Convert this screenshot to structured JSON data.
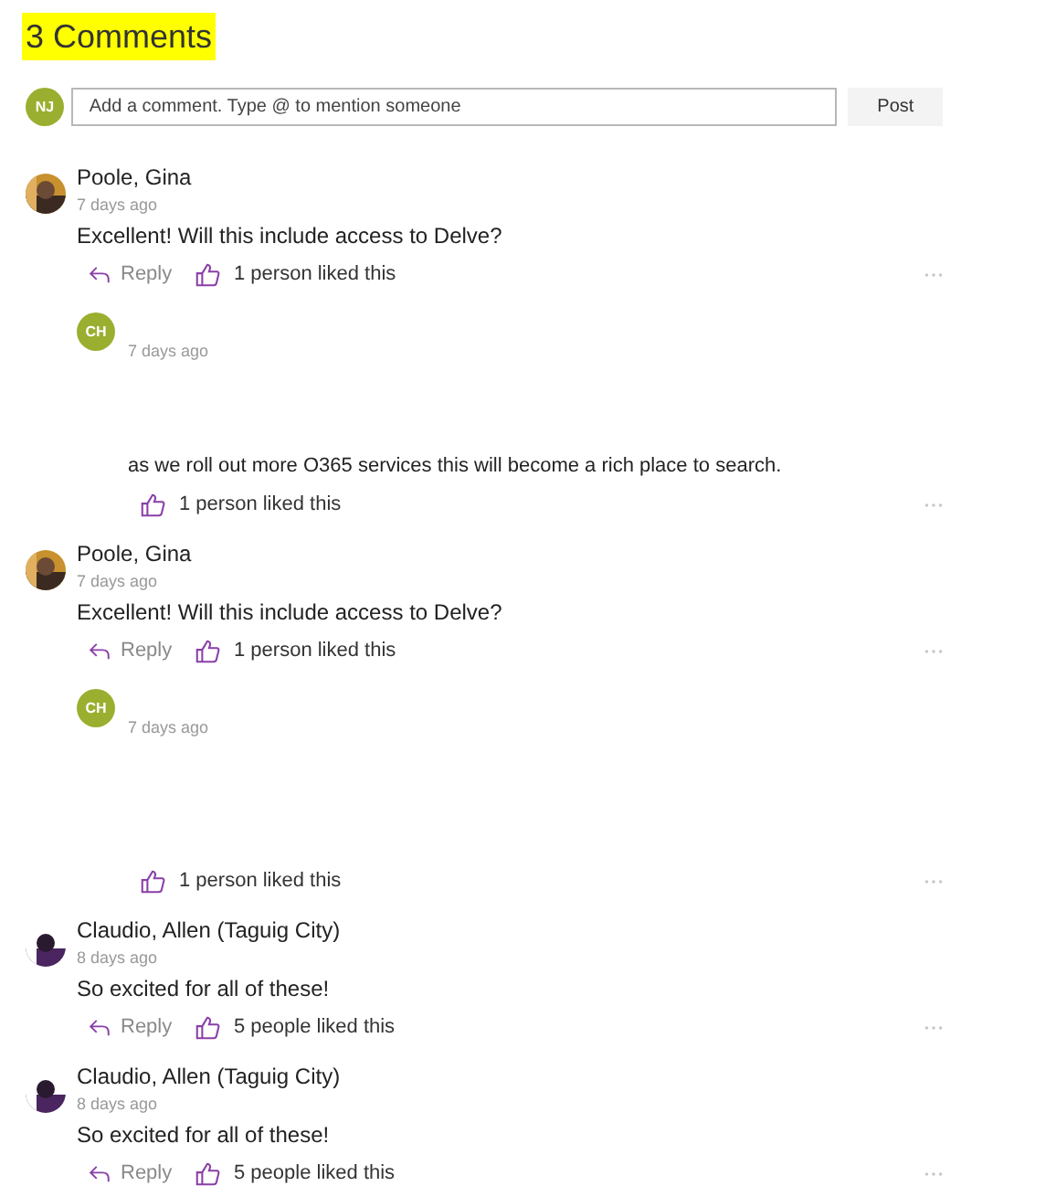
{
  "heading": "3 Comments",
  "composer": {
    "avatar": "NJ",
    "placeholder": "Add a comment. Type @ to mention someone",
    "button": "Post"
  },
  "comments": [
    {
      "author": "Poole, Gina",
      "time": "7 days ago",
      "body": "Excellent! Will this include access to Delve?",
      "reply": "Reply",
      "likes": "1 person liked this",
      "replies": [
        {
          "initials": "CH",
          "time": "7 days ago",
          "body": "as we roll out more O365 services this will become a rich place to search.",
          "likes": "1 person liked this"
        }
      ]
    },
    {
      "author": "Poole, Gina",
      "time": "7 days ago",
      "body": "Excellent! Will this include access to Delve?",
      "reply": "Reply",
      "likes": "1 person liked this",
      "replies": [
        {
          "initials": "CH",
          "time": "7 days ago",
          "likes": "1 person liked this"
        }
      ]
    },
    {
      "author": "Claudio, Allen (Taguig City)",
      "time": "8 days ago",
      "body": "So excited for all of these!",
      "reply": "Reply",
      "likes": "5 people liked this"
    },
    {
      "author": "Claudio, Allen (Taguig City)",
      "time": "8 days ago",
      "body": "So excited for all of these!",
      "reply": "Reply",
      "likes": "5 people liked this"
    }
  ]
}
